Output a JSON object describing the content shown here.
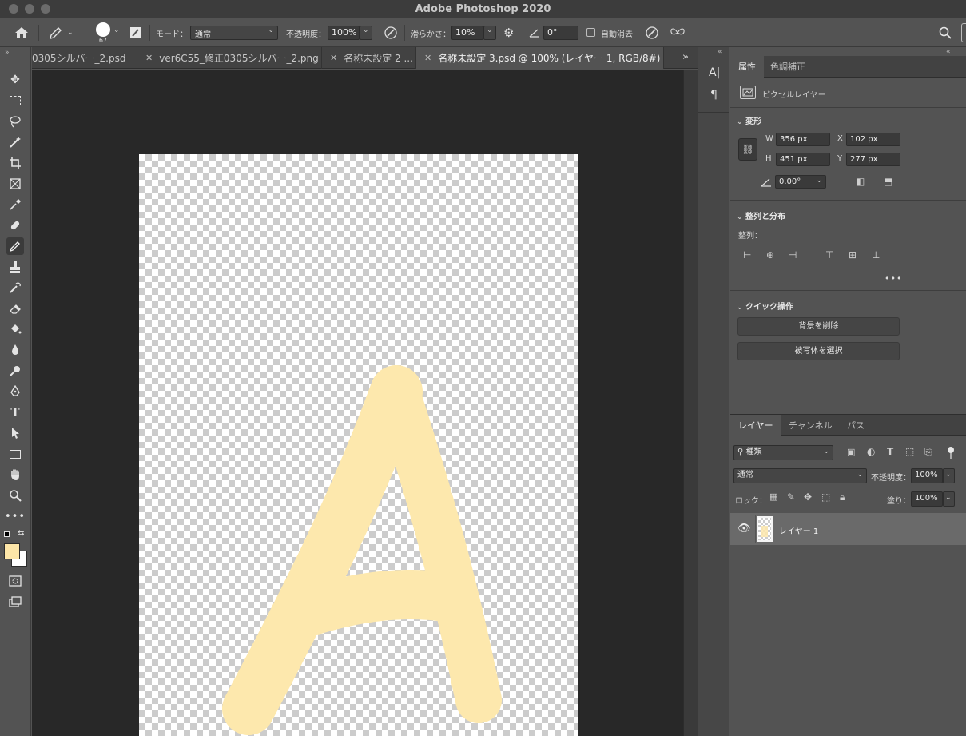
{
  "window": {
    "title": "Adobe Photoshop 2020"
  },
  "options_bar": {
    "brush_size": "67",
    "mode_label": "モード：",
    "mode_value": "通常",
    "opacity_label": "不透明度：",
    "opacity_value": "100%",
    "smoothing_label": "滑らかさ：",
    "smoothing_value": "10%",
    "angle_value": "0°",
    "auto_erase_label": "自動消去"
  },
  "tabs": [
    {
      "label": "0305シルバー_2.psd",
      "active": false
    },
    {
      "label": "ver6C55_修正0305シルバー_2.png",
      "active": false
    },
    {
      "label": "名称未設定 2 ...",
      "active": false
    },
    {
      "label": "名称未設定 3.psd @ 100% (レイヤー 1, RGB/8#) *",
      "active": true
    }
  ],
  "properties_panel": {
    "tabs": [
      "属性",
      "色調補正"
    ],
    "layer_type": "ピクセルレイヤー",
    "transform_title": "変形",
    "w_label": "W",
    "w_value": "356 px",
    "x_label": "X",
    "x_value": "102 px",
    "h_label": "H",
    "h_value": "451 px",
    "y_label": "Y",
    "y_value": "277 px",
    "angle_value": "0.00°",
    "align_title": "整列と分布",
    "align_label": "整列：",
    "quick_title": "クイック操作",
    "remove_bg_button": "背景を削除",
    "select_subject_button": "被写体を選択"
  },
  "layers_panel": {
    "tabs": [
      "レイヤー",
      "チャンネル",
      "パス"
    ],
    "filter_value": "種類",
    "blend_value": "通常",
    "opacity_label": "不透明度：",
    "opacity_value": "100%",
    "lock_label": "ロック：",
    "fill_label": "塗り：",
    "fill_value": "100%",
    "layers": [
      {
        "name": "レイヤー 1",
        "visible": true
      }
    ]
  },
  "colors": {
    "foreground": "#fde6a8",
    "background": "#ffffff",
    "stroke": "#fde8ad"
  }
}
